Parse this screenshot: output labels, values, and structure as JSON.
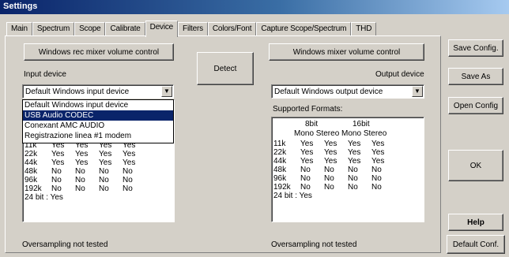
{
  "window": {
    "title": "Settings"
  },
  "tabs": [
    "Main",
    "Spectrum",
    "Scope",
    "Calibrate",
    "Device",
    "Filters",
    "Colors/Font",
    "Capture Scope/Spectrum",
    "THD"
  ],
  "active_tab": "Device",
  "buttons": {
    "rec_mixer": "Windows rec mixer volume control",
    "detect": "Detect",
    "mixer": "Windows mixer volume control",
    "save_config": "Save Config.",
    "save_as": "Save As",
    "open_config": "Open Config",
    "ok": "OK",
    "help": "Help",
    "default_conf": "Default Conf."
  },
  "input": {
    "label": "Input device",
    "selected": "Default Windows input device",
    "options": [
      "Default Windows input device",
      "USB Audio CODEC",
      "Conexant AMC AUDIO",
      "Registrazione linea #1 modem"
    ],
    "highlighted_index": 1,
    "rows": [
      {
        "rate": "11k",
        "v": [
          "Yes",
          "Yes",
          "Yes",
          "Yes"
        ]
      },
      {
        "rate": "22k",
        "v": [
          "Yes",
          "Yes",
          "Yes",
          "Yes"
        ]
      },
      {
        "rate": "44k",
        "v": [
          "Yes",
          "Yes",
          "Yes",
          "Yes"
        ]
      },
      {
        "rate": "48k",
        "v": [
          "No",
          "No",
          "No",
          "No"
        ]
      },
      {
        "rate": "96k",
        "v": [
          "No",
          "No",
          "No",
          "No"
        ]
      },
      {
        "rate": "192k",
        "v": [
          "No",
          "No",
          "No",
          "No"
        ]
      }
    ],
    "bit24": "24 bit : Yes",
    "status": "Oversampling not tested"
  },
  "output": {
    "label": "Output device",
    "selected": "Default Windows output device",
    "formats_label": "Supported Formats:",
    "hdr_8bit": "8bit",
    "hdr_16bit": "16bit",
    "hdr_mono_stereo": "Mono Stereo Mono Stereo",
    "rows": [
      {
        "rate": "11k",
        "v": [
          "Yes",
          "Yes",
          "Yes",
          "Yes"
        ]
      },
      {
        "rate": "22k",
        "v": [
          "Yes",
          "Yes",
          "Yes",
          "Yes"
        ]
      },
      {
        "rate": "44k",
        "v": [
          "Yes",
          "Yes",
          "Yes",
          "Yes"
        ]
      },
      {
        "rate": "48k",
        "v": [
          "No",
          "No",
          "No",
          "No"
        ]
      },
      {
        "rate": "96k",
        "v": [
          "No",
          "No",
          "No",
          "No"
        ]
      },
      {
        "rate": "192k",
        "v": [
          "No",
          "No",
          "No",
          "No"
        ]
      }
    ],
    "bit24": "24 bit : Yes",
    "status": "Oversampling not tested"
  }
}
